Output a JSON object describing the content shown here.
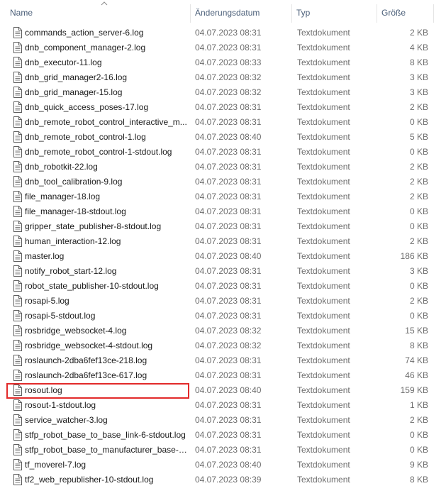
{
  "columns": {
    "name": "Name",
    "date": "Änderungsdatum",
    "type": "Typ",
    "size": "Größe"
  },
  "files": [
    {
      "name": "commands_action_server-6.log",
      "date": "04.07.2023 08:31",
      "type": "Textdokument",
      "size": "2 KB"
    },
    {
      "name": "dnb_component_manager-2.log",
      "date": "04.07.2023 08:31",
      "type": "Textdokument",
      "size": "4 KB"
    },
    {
      "name": "dnb_executor-11.log",
      "date": "04.07.2023 08:33",
      "type": "Textdokument",
      "size": "8 KB"
    },
    {
      "name": "dnb_grid_manager2-16.log",
      "date": "04.07.2023 08:32",
      "type": "Textdokument",
      "size": "3 KB"
    },
    {
      "name": "dnb_grid_manager-15.log",
      "date": "04.07.2023 08:32",
      "type": "Textdokument",
      "size": "3 KB"
    },
    {
      "name": "dnb_quick_access_poses-17.log",
      "date": "04.07.2023 08:31",
      "type": "Textdokument",
      "size": "2 KB"
    },
    {
      "name": "dnb_remote_robot_control_interactive_m...",
      "date": "04.07.2023 08:31",
      "type": "Textdokument",
      "size": "0 KB"
    },
    {
      "name": "dnb_remote_robot_control-1.log",
      "date": "04.07.2023 08:40",
      "type": "Textdokument",
      "size": "5 KB"
    },
    {
      "name": "dnb_remote_robot_control-1-stdout.log",
      "date": "04.07.2023 08:31",
      "type": "Textdokument",
      "size": "0 KB"
    },
    {
      "name": "dnb_robotkit-22.log",
      "date": "04.07.2023 08:31",
      "type": "Textdokument",
      "size": "2 KB"
    },
    {
      "name": "dnb_tool_calibration-9.log",
      "date": "04.07.2023 08:31",
      "type": "Textdokument",
      "size": "2 KB"
    },
    {
      "name": "file_manager-18.log",
      "date": "04.07.2023 08:31",
      "type": "Textdokument",
      "size": "2 KB"
    },
    {
      "name": "file_manager-18-stdout.log",
      "date": "04.07.2023 08:31",
      "type": "Textdokument",
      "size": "0 KB"
    },
    {
      "name": "gripper_state_publisher-8-stdout.log",
      "date": "04.07.2023 08:31",
      "type": "Textdokument",
      "size": "0 KB"
    },
    {
      "name": "human_interaction-12.log",
      "date": "04.07.2023 08:31",
      "type": "Textdokument",
      "size": "2 KB"
    },
    {
      "name": "master.log",
      "date": "04.07.2023 08:40",
      "type": "Textdokument",
      "size": "186 KB"
    },
    {
      "name": "notify_robot_start-12.log",
      "date": "04.07.2023 08:31",
      "type": "Textdokument",
      "size": "3 KB"
    },
    {
      "name": "robot_state_publisher-10-stdout.log",
      "date": "04.07.2023 08:31",
      "type": "Textdokument",
      "size": "0 KB"
    },
    {
      "name": "rosapi-5.log",
      "date": "04.07.2023 08:31",
      "type": "Textdokument",
      "size": "2 KB"
    },
    {
      "name": "rosapi-5-stdout.log",
      "date": "04.07.2023 08:31",
      "type": "Textdokument",
      "size": "0 KB"
    },
    {
      "name": "rosbridge_websocket-4.log",
      "date": "04.07.2023 08:32",
      "type": "Textdokument",
      "size": "15 KB"
    },
    {
      "name": "rosbridge_websocket-4-stdout.log",
      "date": "04.07.2023 08:32",
      "type": "Textdokument",
      "size": "8 KB"
    },
    {
      "name": "roslaunch-2dba6fef13ce-218.log",
      "date": "04.07.2023 08:31",
      "type": "Textdokument",
      "size": "74 KB"
    },
    {
      "name": "roslaunch-2dba6fef13ce-617.log",
      "date": "04.07.2023 08:31",
      "type": "Textdokument",
      "size": "46 KB"
    },
    {
      "name": "rosout.log",
      "date": "04.07.2023 08:40",
      "type": "Textdokument",
      "size": "159 KB"
    },
    {
      "name": "rosout-1-stdout.log",
      "date": "04.07.2023 08:31",
      "type": "Textdokument",
      "size": "1 KB"
    },
    {
      "name": "service_watcher-3.log",
      "date": "04.07.2023 08:31",
      "type": "Textdokument",
      "size": "2 KB"
    },
    {
      "name": "stfp_robot_base_to_base_link-6-stdout.log",
      "date": "04.07.2023 08:31",
      "type": "Textdokument",
      "size": "0 KB"
    },
    {
      "name": "stfp_robot_base_to_manufacturer_base-7...",
      "date": "04.07.2023 08:31",
      "type": "Textdokument",
      "size": "0 KB"
    },
    {
      "name": "tf_moverel-7.log",
      "date": "04.07.2023 08:40",
      "type": "Textdokument",
      "size": "9 KB"
    },
    {
      "name": "tf2_web_republisher-10-stdout.log",
      "date": "04.07.2023 08:39",
      "type": "Textdokument",
      "size": "8 KB"
    }
  ],
  "highlight_color": "#e22a2a",
  "icon": "text-document-icon",
  "sort_icon": "sort-ascending-icon"
}
